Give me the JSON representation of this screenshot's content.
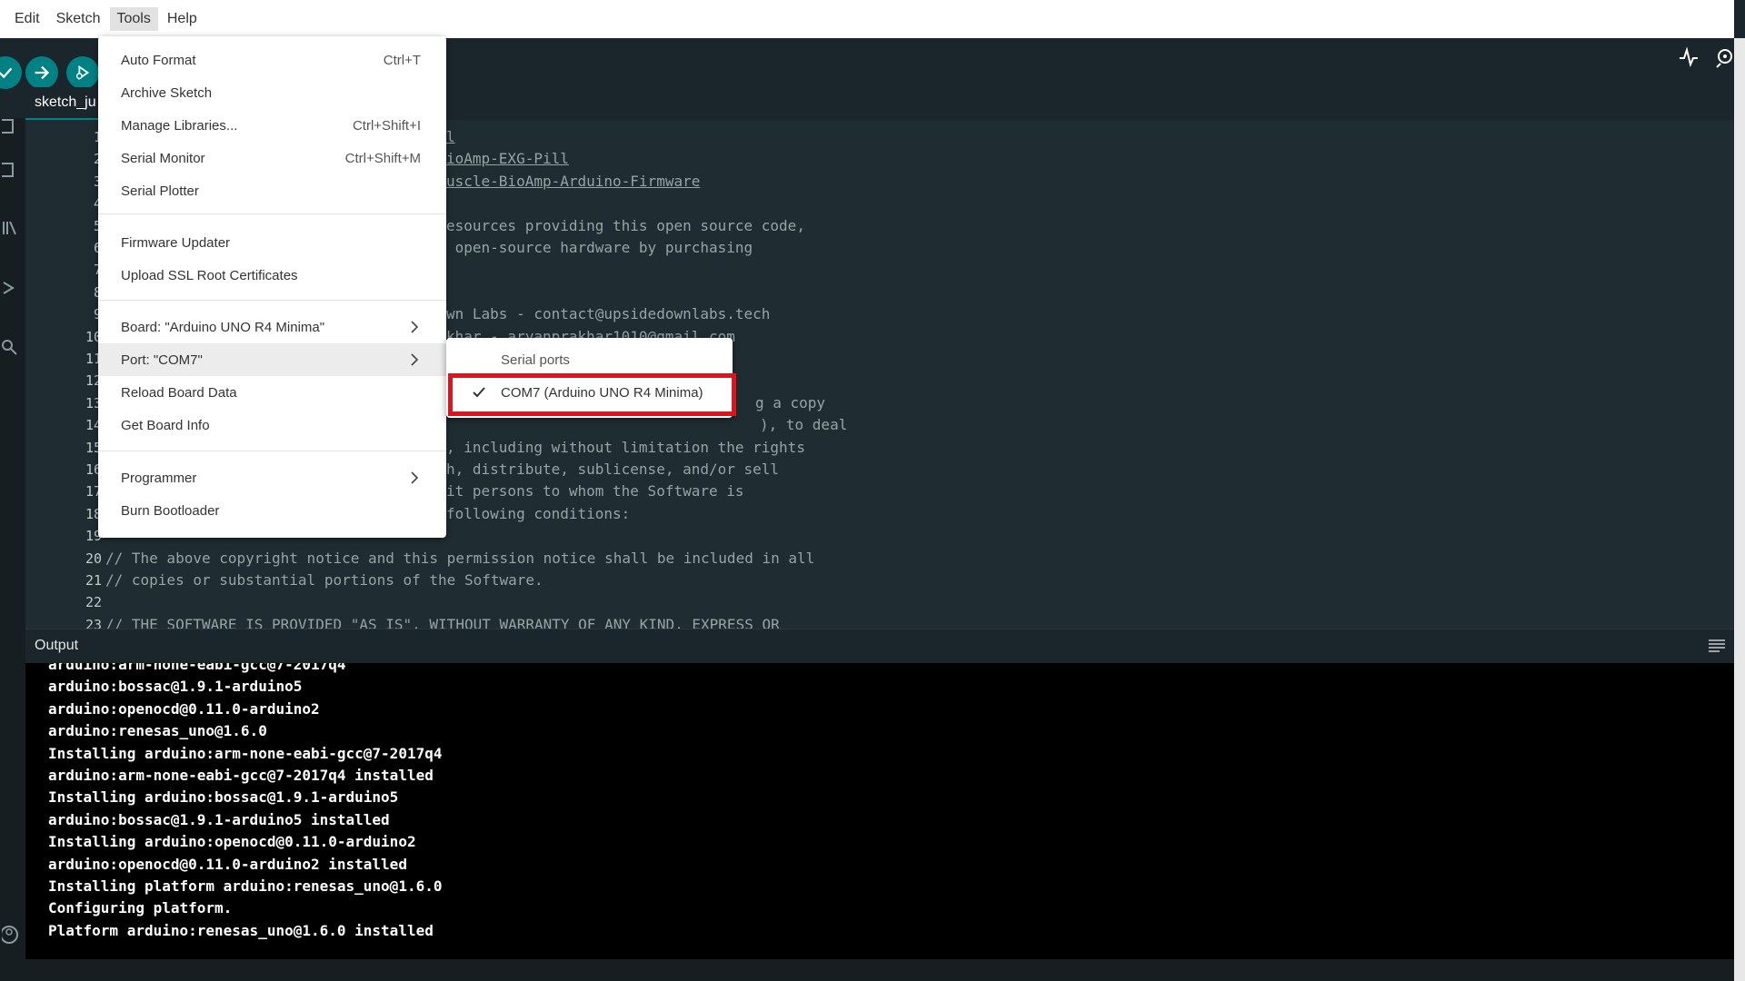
{
  "menubar": {
    "items": [
      "Edit",
      "Sketch",
      "Tools",
      "Help"
    ],
    "active": "Tools"
  },
  "editor": {
    "tab_label": "sketch_ju",
    "line_numbers": [
      "1",
      "2",
      "3",
      "4",
      "5",
      "6",
      "7",
      "8",
      "9",
      "10",
      "11",
      "12",
      "13",
      "14",
      "15",
      "16",
      "17",
      "18",
      "19",
      "20",
      "21",
      "22",
      "23"
    ],
    "visible_code": [
      {
        "line": 1,
        "text": "l"
      },
      {
        "line": 2,
        "text": "ioAmp-EXG-Pill"
      },
      {
        "line": 3,
        "text": "uscle-BioAmp-Arduino-Firmware"
      },
      {
        "line": 5,
        "text": "esources providing this open source code,"
      },
      {
        "line": 6,
        "text": " open-source hardware by purchasing"
      },
      {
        "line": 9,
        "text": "wn Labs - contact@upsidedownlabs.tech"
      },
      {
        "line": 10,
        "text": "khar - aryanprakhar1010@gmail.com"
      },
      {
        "line": 13,
        "text": "g a copy"
      },
      {
        "line": 14,
        "text": "), to deal"
      },
      {
        "line": 15,
        "text": ", including without limitation the rights"
      },
      {
        "line": 16,
        "text": "h, distribute, sublicense, and/or sell"
      },
      {
        "line": 17,
        "text": "it persons to whom the Software is"
      },
      {
        "line": 18,
        "text": "following conditions:"
      },
      {
        "line": 20,
        "text": "// The above copyright notice and this permission notice shall be included in all"
      },
      {
        "line": 21,
        "text": "// copies or substantial portions of the Software."
      },
      {
        "line": 23,
        "text": "// THE SOFTWARE IS PROVIDED \"AS IS\", WITHOUT WARRANTY OF ANY KIND, EXPRESS OR"
      }
    ]
  },
  "output": {
    "title": "Output",
    "lines": [
      "arduino:arm-none-eabi-gcc@7-2017q4",
      "arduino:bossac@1.9.1-arduino5",
      "arduino:openocd@0.11.0-arduino2",
      "arduino:renesas_uno@1.6.0",
      "Installing arduino:arm-none-eabi-gcc@7-2017q4",
      "arduino:arm-none-eabi-gcc@7-2017q4 installed",
      "Installing arduino:bossac@1.9.1-arduino5",
      "arduino:bossac@1.9.1-arduino5 installed",
      "Installing arduino:openocd@0.11.0-arduino2",
      "arduino:openocd@0.11.0-arduino2 installed",
      "Installing platform arduino:renesas_uno@1.6.0",
      "Configuring platform.",
      "Platform arduino:renesas_uno@1.6.0 installed"
    ]
  },
  "tools_menu": {
    "items": [
      {
        "label": "Auto Format",
        "shortcut": "Ctrl+T"
      },
      {
        "label": "Archive Sketch",
        "shortcut": ""
      },
      {
        "label": "Manage Libraries...",
        "shortcut": "Ctrl+Shift+I"
      },
      {
        "label": "Serial Monitor",
        "shortcut": "Ctrl+Shift+M"
      },
      {
        "label": "Serial Plotter",
        "shortcut": ""
      },
      {
        "label": "Firmware Updater",
        "shortcut": ""
      },
      {
        "label": "Upload SSL Root Certificates",
        "shortcut": ""
      },
      {
        "label": "Board: \"Arduino UNO R4 Minima\"",
        "shortcut": ""
      },
      {
        "label": "Port: \"COM7\"",
        "shortcut": ""
      },
      {
        "label": "Reload Board Data",
        "shortcut": ""
      },
      {
        "label": "Get Board Info",
        "shortcut": ""
      },
      {
        "label": "Programmer",
        "shortcut": ""
      },
      {
        "label": "Burn Bootloader",
        "shortcut": ""
      }
    ],
    "hovered": "Port: \"COM7\""
  },
  "port_submenu": {
    "header": "Serial ports",
    "item": "COM7 (Arduino UNO R4 Minima)",
    "checked": true
  },
  "colors": {
    "accent": "#008184",
    "highlight_border": "#e0121b",
    "editor_bg": "#1f2c31",
    "toolbar_bg": "#1b262c"
  },
  "icons": [
    "verify-icon",
    "upload-icon",
    "debug-icon",
    "serial-plotter-icon",
    "serial-monitor-icon",
    "folder-icon",
    "boards-icon",
    "library-icon",
    "debug-sidebar-icon",
    "search-icon",
    "chevron-right-icon",
    "check-icon",
    "output-menu-icon",
    "account-icon"
  ]
}
